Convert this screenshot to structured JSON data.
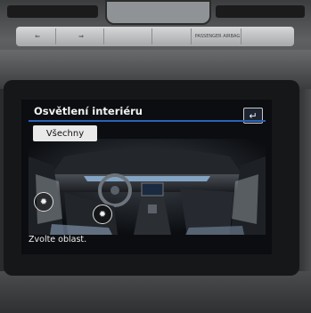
{
  "dashboard": {
    "buttons": [
      "⇐",
      "⇒",
      "",
      "",
      "PASSENGER AIRBAG"
    ]
  },
  "screen": {
    "title": "Osvětlení interiéru",
    "back_icon": "back-arrow-icon",
    "all_button_label": "Všechny",
    "hint": "Zvolte oblast.",
    "zones": [
      {
        "id": "front-left",
        "icon": "sun-icon"
      },
      {
        "id": "rear-left",
        "icon": "sun-icon"
      }
    ],
    "accent_color": "#2a62b8"
  }
}
